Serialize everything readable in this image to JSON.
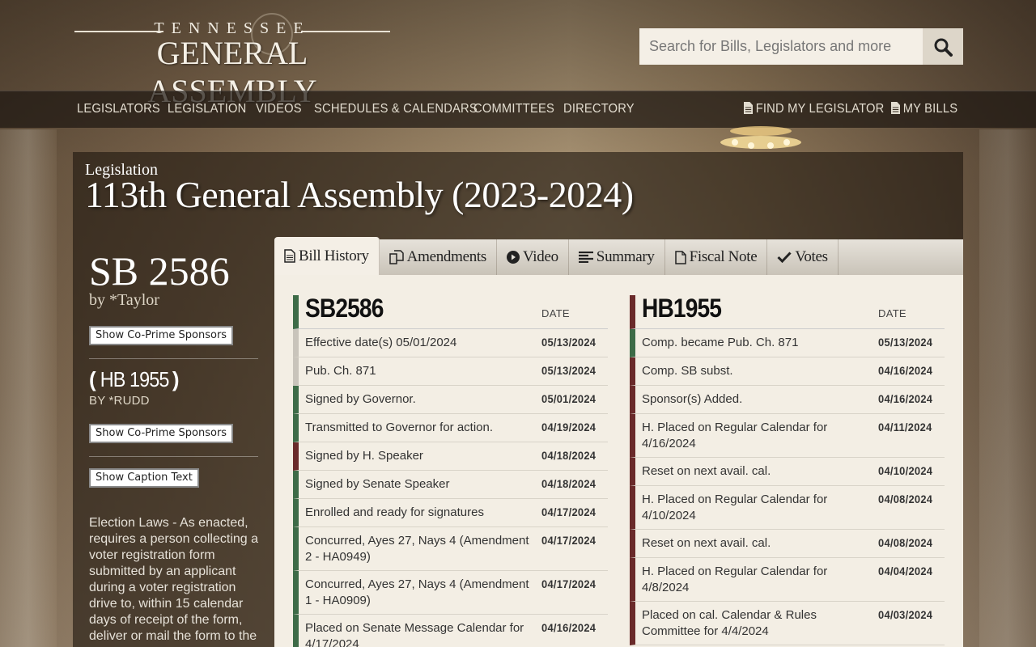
{
  "site": {
    "logo_top": "TENNESSEE",
    "logo_main": "GENERAL ASSEMBLY",
    "search_placeholder": "Search for Bills, Legislators and more"
  },
  "nav": {
    "items": [
      "LEGISLATORS",
      "LEGISLATION",
      "VIDEOS",
      "SCHEDULES & CALENDARS",
      "COMMITTEES",
      "DIRECTORY"
    ],
    "find_legislator": "FIND MY LEGISLATOR",
    "my_bills": "MY BILLS"
  },
  "page": {
    "crumb": "Legislation",
    "title": "113th General Assembly (2023-2024)"
  },
  "sidebar": {
    "bill": "SB 2586",
    "by": "by *Taylor",
    "cosponsor_btn": "Show Co-Prime Sponsors",
    "companion_open": "(",
    "companion": "HB 1955",
    "companion_close": ")",
    "companion_by": "BY *RUDD",
    "cosponsor_btn2": "Show Co-Prime Sponsors",
    "caption_btn": "Show Caption Text",
    "caption": "Election Laws - As enacted, requires a person collecting a voter registration form submitted by an applicant during a voter registration drive to, within 15 calendar days of receipt of the form, deliver or mail the form to the"
  },
  "tabs": [
    "Bill History",
    "Amendments",
    "Video",
    "Summary",
    "Fiscal Note",
    "Votes"
  ],
  "senate": {
    "title": "SB2586",
    "date_label": "DATE",
    "rows": [
      {
        "action": "Effective date(s) 05/01/2024",
        "date": "05/13/2024",
        "color": "gray"
      },
      {
        "action": "Pub. Ch. 871",
        "date": "05/13/2024",
        "color": "gray"
      },
      {
        "action": "Signed by Governor.",
        "date": "05/01/2024",
        "color": "green"
      },
      {
        "action": "Transmitted to Governor for action.",
        "date": "04/19/2024",
        "color": "green"
      },
      {
        "action": "Signed by H. Speaker",
        "date": "04/18/2024",
        "color": "red"
      },
      {
        "action": "Signed by Senate Speaker",
        "date": "04/18/2024",
        "color": "green"
      },
      {
        "action": "Enrolled and ready for signatures",
        "date": "04/17/2024",
        "color": "green"
      },
      {
        "action": "Concurred, Ayes 27, Nays 4 (Amendment 2 - HA0949)",
        "date": "04/17/2024",
        "color": "green"
      },
      {
        "action": "Concurred, Ayes 27, Nays 4 (Amendment 1 - HA0909)",
        "date": "04/17/2024",
        "color": "green"
      },
      {
        "action": "Placed on Senate Message Calendar for 4/17/2024",
        "date": "04/16/2024",
        "color": "green"
      }
    ]
  },
  "house": {
    "title": "HB1955",
    "date_label": "DATE",
    "rows": [
      {
        "action": "Comp. became Pub. Ch. 871",
        "date": "05/13/2024",
        "color": "green"
      },
      {
        "action": "Comp. SB subst.",
        "date": "04/16/2024",
        "color": "red"
      },
      {
        "action": "Sponsor(s) Added.",
        "date": "04/16/2024",
        "color": "red"
      },
      {
        "action": "H. Placed on Regular Calendar for 4/16/2024",
        "date": "04/11/2024",
        "color": "red"
      },
      {
        "action": "Reset on next avail. cal.",
        "date": "04/10/2024",
        "color": "red"
      },
      {
        "action": "H. Placed on Regular Calendar for 4/10/2024",
        "date": "04/08/2024",
        "color": "red"
      },
      {
        "action": "Reset on next avail. cal.",
        "date": "04/08/2024",
        "color": "red"
      },
      {
        "action": "H. Placed on Regular Calendar for 4/8/2024",
        "date": "04/04/2024",
        "color": "red"
      },
      {
        "action": "Placed on cal. Calendar & Rules Committee for 4/4/2024",
        "date": "04/03/2024",
        "color": "red"
      }
    ]
  }
}
